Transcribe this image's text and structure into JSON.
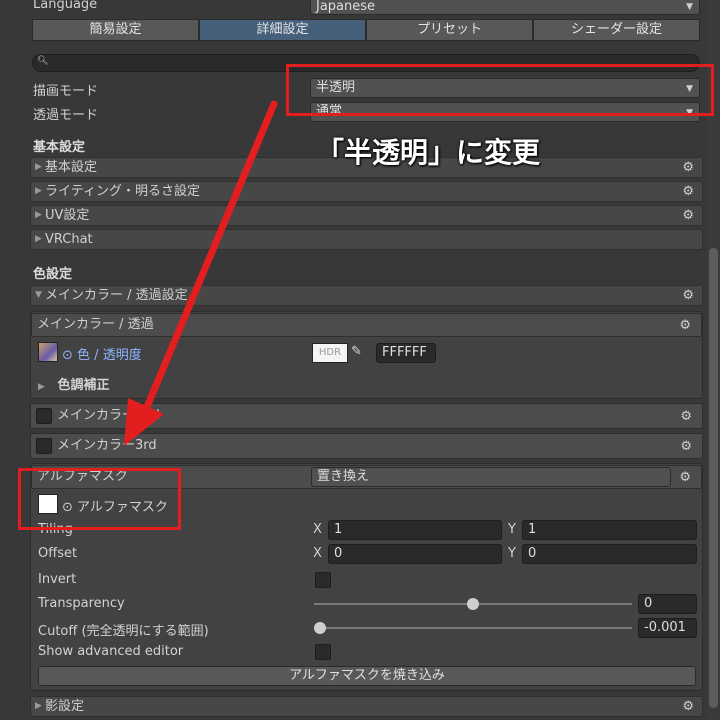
{
  "language": {
    "label": "Language",
    "value": "Japanese"
  },
  "tabs": [
    {
      "label": "簡易設定",
      "active": false
    },
    {
      "label": "詳細設定",
      "active": true
    },
    {
      "label": "プリセット",
      "active": false
    },
    {
      "label": "シェーダー設定",
      "active": false
    }
  ],
  "render_mode": {
    "label": "描画モード",
    "value": "半透明"
  },
  "transparent_mode": {
    "label": "透過モード",
    "value": "通常"
  },
  "annotation": {
    "text": "「半透明」に変更",
    "color": "#e31e1e"
  },
  "basic_section": {
    "title": "基本設定",
    "items": [
      "基本設定",
      "ライティング・明るさ設定",
      "UV設定",
      "VRChat"
    ]
  },
  "color_section": {
    "title": "色設定",
    "main_fold": "メインカラー / 透過設定",
    "main_box_title": "メインカラー / 透過",
    "color_label": "色 / 透明度",
    "hdr_label": "HDR",
    "hex_value": "FFFFFF",
    "color_correction": "色調補正",
    "main_2nd": "メインカラー2nd",
    "main_3rd": "メインカラー3rd"
  },
  "alpha_mask": {
    "title": "アルファマスク",
    "mode": "置き換え",
    "texture_label": "アルファマスク",
    "tiling": {
      "label": "Tiling",
      "x_label": "X",
      "x": "1",
      "y_label": "Y",
      "y": "1"
    },
    "offset": {
      "label": "Offset",
      "x_label": "X",
      "x": "0",
      "y_label": "Y",
      "y": "0"
    },
    "invert_label": "Invert",
    "transparency": {
      "label": "Transparency",
      "value": "0",
      "fraction": 0.5
    },
    "cutoff": {
      "label": "Cutoff (完全透明にする範囲)",
      "value": "-0.001",
      "fraction": 0.0
    },
    "advanced_label": "Show advanced editor",
    "bake_button": "アルファマスクを焼き込み"
  },
  "shadow_fold": "影設定",
  "colors": {
    "accent_tab": "#46607c",
    "annotation_red": "#e31e1e"
  }
}
